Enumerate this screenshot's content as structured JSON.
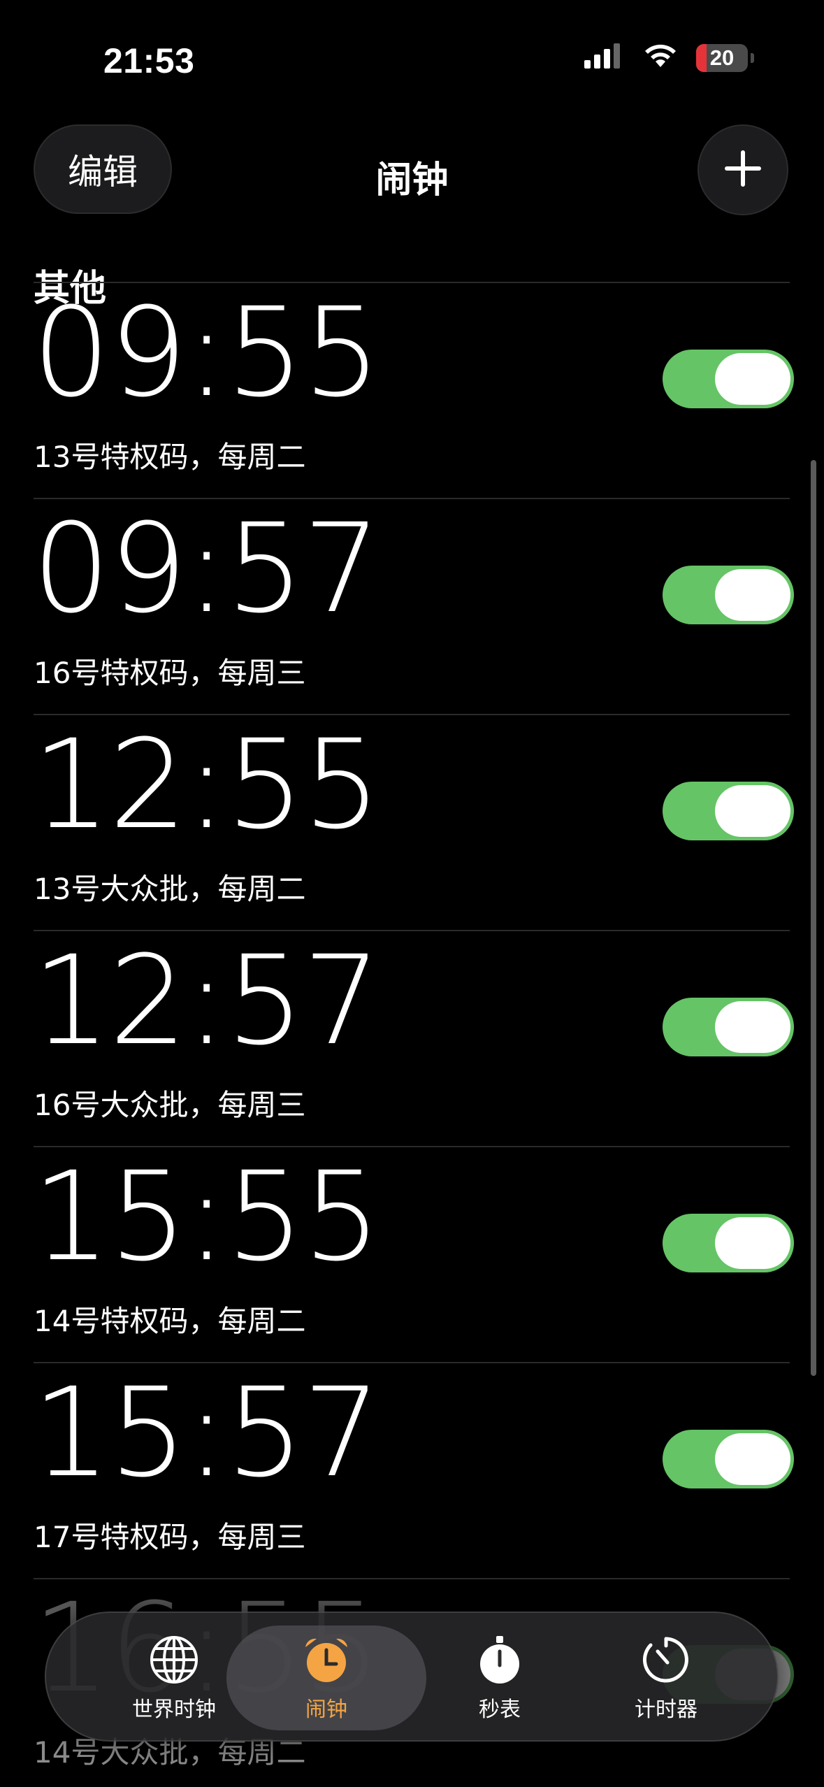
{
  "status_bar": {
    "time": "21:53",
    "battery_level": "20",
    "battery_fill": 0.2,
    "icons": [
      "signal-icon",
      "wifi-icon",
      "battery-icon"
    ]
  },
  "nav": {
    "edit_label": "编辑",
    "title": "闹钟",
    "add_icon": "plus-icon"
  },
  "section": {
    "title": "其他"
  },
  "colors": {
    "toggle_on": "#65c466",
    "tab_active": "#f5a443",
    "background": "#000000"
  },
  "alarms": [
    {
      "time": "09:55",
      "label": "13号特权码，每周二",
      "enabled": true
    },
    {
      "time": "09:57",
      "label": "16号特权码，每周三",
      "enabled": true
    },
    {
      "time": "12:55",
      "label": "13号大众批，每周二",
      "enabled": true
    },
    {
      "time": "12:57",
      "label": "16号大众批，每周三",
      "enabled": true
    },
    {
      "time": "15:55",
      "label": "14号特权码，每周二",
      "enabled": true
    },
    {
      "time": "15:57",
      "label": "17号特权码，每周三",
      "enabled": true
    },
    {
      "time": "16:55",
      "label": "14号大众批，每周二",
      "enabled": true
    }
  ],
  "tabs": [
    {
      "label": "世界时钟",
      "icon": "globe-icon",
      "active": false
    },
    {
      "label": "闹钟",
      "icon": "alarm-clock-icon",
      "active": true
    },
    {
      "label": "秒表",
      "icon": "stopwatch-icon",
      "active": false
    },
    {
      "label": "计时器",
      "icon": "timer-icon",
      "active": false
    }
  ]
}
